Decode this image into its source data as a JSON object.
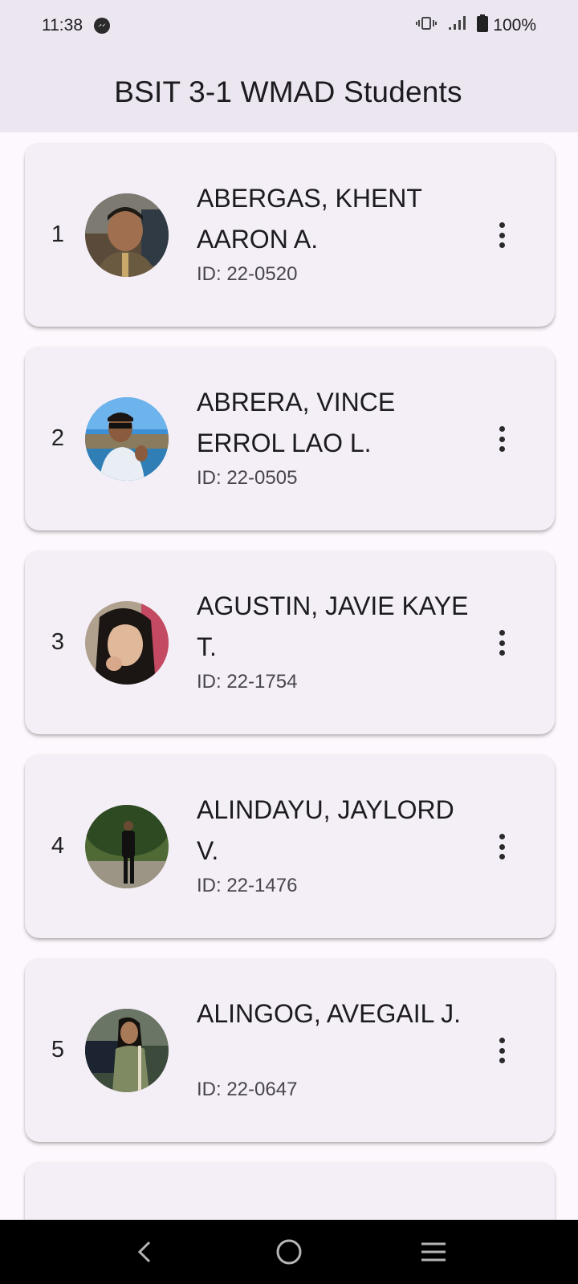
{
  "status_bar": {
    "time": "11:38",
    "notification_icon": "messenger-icon",
    "vibrate_icon": "vibrate-icon",
    "signal_icon": "signal-icon",
    "battery_icon": "battery-icon",
    "battery": "100%"
  },
  "app_bar": {
    "title": "BSIT 3-1 WMAD Students"
  },
  "students": [
    {
      "num": "1",
      "name": "ABERGAS, KHENT AARON A.",
      "id": "ID: 22-0520"
    },
    {
      "num": "2",
      "name": "ABRERA, VINCE ERROL LAO L.",
      "id": "ID: 22-0505"
    },
    {
      "num": "3",
      "name": "AGUSTIN, JAVIE KAYE T.",
      "id": "ID: 22-1754"
    },
    {
      "num": "4",
      "name": "ALINDAYU, JAYLORD V.",
      "id": "ID: 22-1476"
    },
    {
      "num": "5",
      "name": "ALINGOG, AVEGAIL J.",
      "id": "ID: 22-0647"
    }
  ],
  "nav_bar": {
    "back_icon": "back-icon",
    "home_icon": "home-icon",
    "recents_icon": "recents-icon"
  },
  "colors": {
    "app_bar_bg": "#ece6f0",
    "card_bg": "#f4eff6",
    "page_bg": "#fdf8fd"
  }
}
